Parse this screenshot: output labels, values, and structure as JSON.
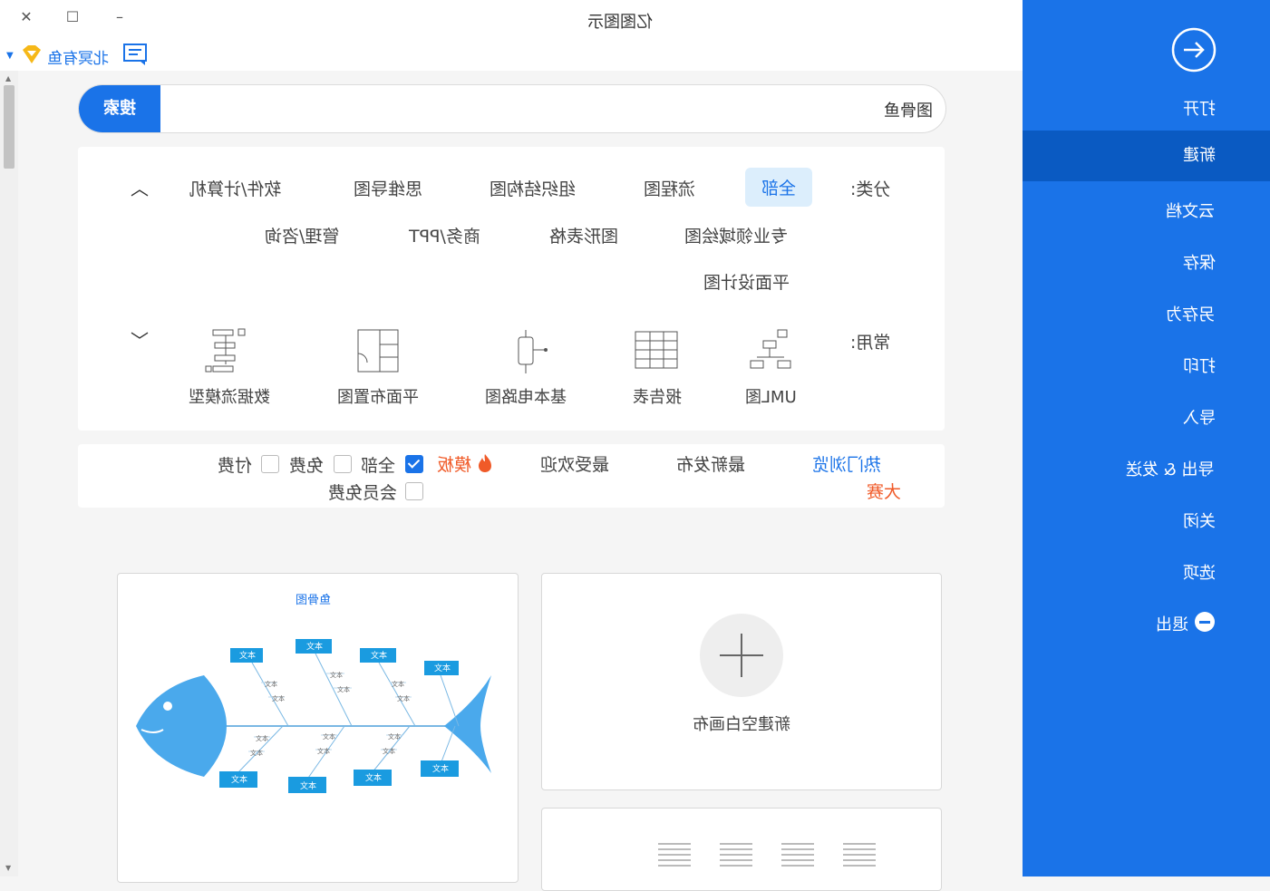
{
  "window": {
    "title": "亿图图示",
    "close_glyph": "✕",
    "maximize_glyph": "☐",
    "minimize_glyph": "–"
  },
  "user": {
    "name": "北冥有鱼"
  },
  "search": {
    "button": "搜索",
    "value": "鱼骨图"
  },
  "categories": {
    "label": "分类:",
    "items": [
      "全部",
      "流程图",
      "组织结构图",
      "思维导图",
      "软件/计算机",
      "专业领域绘图",
      "图形表格",
      "商务/PPT",
      "管理/咨询",
      "平面设计图"
    ]
  },
  "common": {
    "label": "常用:",
    "items": [
      "UML图",
      "报告表",
      "基本电路图",
      "平面布置图",
      "数据流模型"
    ]
  },
  "filter": {
    "tabs": [
      "热门浏览",
      "最新发布",
      "最受欢迎",
      "模板"
    ],
    "contest": "大赛",
    "options": [
      {
        "label": "全部",
        "checked": true
      },
      {
        "label": "免费",
        "checked": false
      },
      {
        "label": "付费",
        "checked": false
      },
      {
        "label": "会员免费",
        "checked": false
      }
    ]
  },
  "cards": {
    "fishbone": {
      "title": "鱼骨图",
      "box_label": "文本",
      "sub_label": "文本"
    },
    "blank": {
      "label": "新建空白画布"
    }
  },
  "sidebar": {
    "items": [
      "打开",
      "新建",
      "云文档",
      "保存",
      "另存为",
      "打印",
      "导入",
      "导出 & 发送",
      "关闭",
      "选项",
      "退出"
    ],
    "active": "新建",
    "accent": "#1a73e8",
    "active_color": "#0a5ac2"
  }
}
